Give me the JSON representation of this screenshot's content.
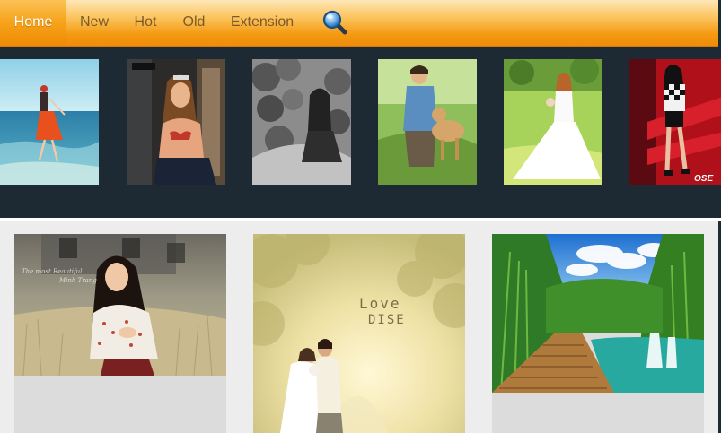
{
  "nav": {
    "items": [
      {
        "label": "Home",
        "active": true
      },
      {
        "label": "New",
        "active": false
      },
      {
        "label": "Hot",
        "active": false
      },
      {
        "label": "Old",
        "active": false
      },
      {
        "label": "Extension",
        "active": false
      }
    ],
    "search_icon": "magnifier-icon",
    "accent_color": "#f49a12",
    "strip_color": "#1e2a33"
  },
  "thumbnails": [
    {
      "subject": "girl-on-beach"
    },
    {
      "subject": "girl-in-bikini-window"
    },
    {
      "subject": "black-white-lotus-girl"
    },
    {
      "subject": "boy-with-dog"
    },
    {
      "subject": "bride-in-field"
    },
    {
      "subject": "model-red-stage",
      "brand": "OSE"
    }
  ],
  "cards": [
    {
      "subject": "girl-in-grass-field",
      "caption_line1": "The most Beautiful",
      "caption_line2": "Minh Trang"
    },
    {
      "subject": "wedding-couple-forest",
      "overlay_line1": "Love",
      "overlay_line2": "DISE"
    },
    {
      "subject": "waterfall-landscape"
    }
  ]
}
